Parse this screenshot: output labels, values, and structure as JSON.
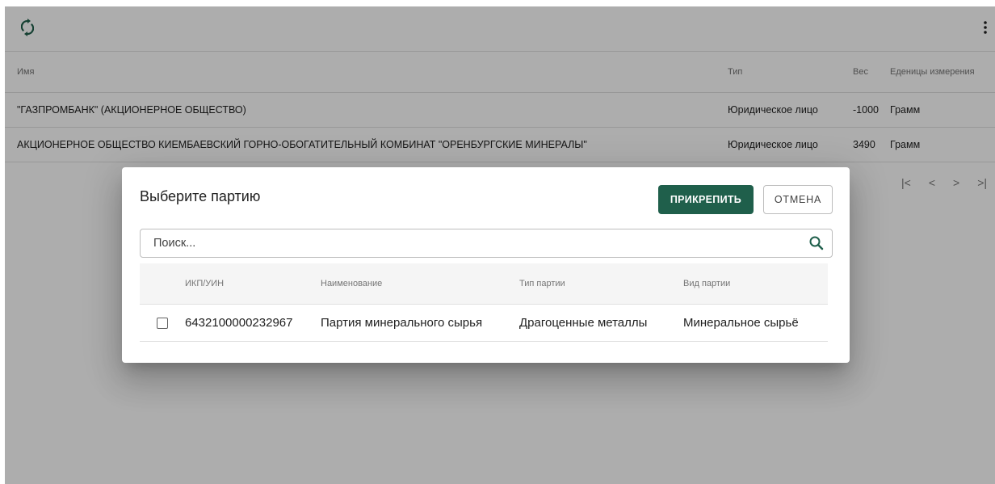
{
  "toolbar": {
    "refresh_icon": "refresh-icon",
    "menu_icon": "more-vert-icon"
  },
  "table": {
    "columns": [
      "Имя",
      "Тип",
      "Вес",
      "Еденицы измерения"
    ],
    "rows": [
      {
        "name": "\"ГАЗПРОМБАНК\" (АКЦИОНЕРНОЕ ОБЩЕСТВО)",
        "type": "Юридическое лицо",
        "weight": "-1000",
        "unit": "Грамм"
      },
      {
        "name": "АКЦИОНЕРНОЕ ОБЩЕСТВО КИЕМБАЕВСКИЙ ГОРНО-ОБОГАТИТЕЛЬНЫЙ КОМБИНАТ \"ОРЕНБУРГСКИЕ МИНЕРАЛЫ\"",
        "type": "Юридическое лицо",
        "weight": "3490",
        "unit": "Грамм"
      }
    ]
  },
  "pagination": {
    "first": "|<",
    "prev": "<",
    "next": ">",
    "last": ">|"
  },
  "dialog": {
    "title": "Выберите партию",
    "attach_label": "ПРИКРЕПИТЬ",
    "cancel_label": "ОТМЕНА",
    "search_placeholder": "Поиск...",
    "search_value": "",
    "columns": [
      "ИКП/УИН",
      "Наименование",
      "Тип партии",
      "Вид партии"
    ],
    "rows": [
      {
        "checked": false,
        "ikp": "6432100000232967",
        "name": "Партия минерального сырья",
        "batch_type": "Драгоценные металлы",
        "batch_kind": "Минеральное сырьё"
      }
    ]
  },
  "colors": {
    "primary": "#1f5f4b",
    "overlay": "rgba(0,0,0,0.32)"
  }
}
